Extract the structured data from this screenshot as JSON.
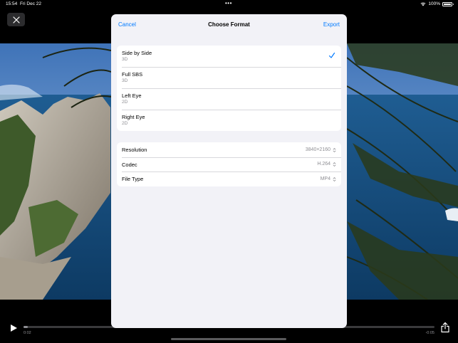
{
  "status_bar": {
    "time": "15:54",
    "date": "Fri Dec 22",
    "multitask_dots": "•••",
    "battery": "100%",
    "icons": [
      "wifi-icon",
      "battery-icon"
    ]
  },
  "player": {
    "elapsed": "0:02",
    "remaining": "-0:05",
    "progress_fraction": 0.01,
    "icons": [
      "close-icon",
      "play-icon",
      "share-icon"
    ]
  },
  "dialog": {
    "title": "Choose Format",
    "cancel_label": "Cancel",
    "export_label": "Export",
    "formats": [
      {
        "name": "Side by Side",
        "dimension": "3D",
        "selected": true
      },
      {
        "name": "Full SBS",
        "dimension": "3D",
        "selected": false
      },
      {
        "name": "Left Eye",
        "dimension": "2D",
        "selected": false
      },
      {
        "name": "Right Eye",
        "dimension": "2D",
        "selected": false
      }
    ],
    "settings": [
      {
        "label": "Resolution",
        "value": "3840×2160"
      },
      {
        "label": "Codec",
        "value": "H.264"
      },
      {
        "label": "File Type",
        "value": "MP4"
      }
    ]
  },
  "colors": {
    "accent": "#007aff",
    "background": "#000000",
    "sheet": "#f2f2f7",
    "secondary_text": "#8e8e93"
  }
}
